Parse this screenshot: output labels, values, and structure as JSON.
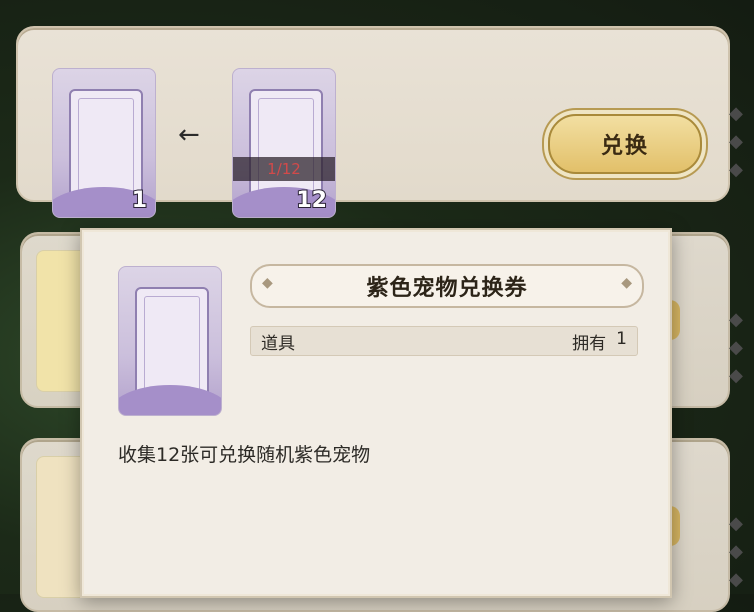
{
  "exchange_row": {
    "source_card": {
      "count": "1"
    },
    "target_card": {
      "progress": "1/12",
      "count": "12"
    },
    "arrow_glyph": "←",
    "exchange_button_label": "兑换"
  },
  "tooltip": {
    "item_name": "紫色宠物兑换券",
    "category": "道具",
    "owned_label": "拥有",
    "owned_count": "1",
    "description": "收集12张可兑换随机紫色宠物"
  },
  "colors": {
    "accent_gold": "#e2c06a",
    "progress_red": "#d24a4a",
    "card_purple": "#a58fc9"
  },
  "icons": [
    "arrow-left-icon",
    "diamond-deco-icon",
    "purple-pet-ticket-icon"
  ]
}
